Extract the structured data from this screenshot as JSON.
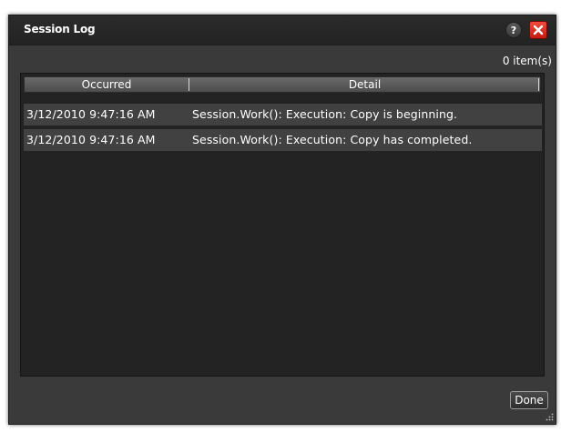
{
  "window": {
    "title": "Session Log",
    "help_label": "?"
  },
  "log": {
    "count_text": "0 item(s)",
    "columns": [
      "Occurred",
      "Detail"
    ],
    "rows": [
      {
        "occurred": "3/12/2010 9:47:16 AM",
        "detail": "Session.Work(): Execution: Copy is beginning."
      },
      {
        "occurred": "3/12/2010 9:47:16 AM",
        "detail": "Session.Work(): Execution: Copy has completed."
      }
    ]
  },
  "footer": {
    "done_label": "Done"
  },
  "colors": {
    "dialog_bg": "#3a3a3a",
    "grid_bg": "#232323",
    "row_bg": "#414141",
    "close_red": "#e0291d"
  }
}
